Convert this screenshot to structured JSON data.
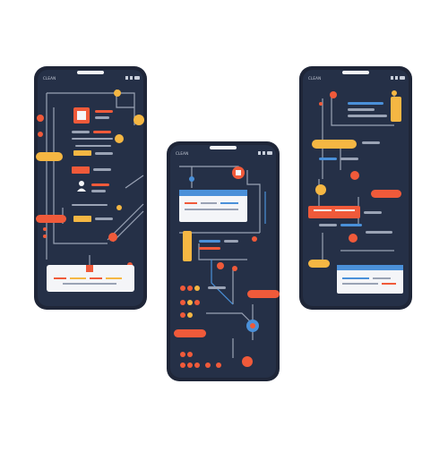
{
  "colors": {
    "background": "#ffffff",
    "phone_body": "#1f2638",
    "phone_screen": "#253047",
    "accent_orange": "#f05a3a",
    "accent_yellow": "#f5b743",
    "accent_blue": "#4a90d9",
    "line_light": "#9aa3b5",
    "card_white": "#f4f5f8"
  },
  "phones": [
    {
      "status_time": "CLEAN",
      "icons": [
        "signal-icon",
        "wifi-icon",
        "battery-icon"
      ]
    },
    {
      "status_time": "CLEAN",
      "icons": [
        "signal-icon",
        "wifi-icon",
        "battery-icon"
      ]
    },
    {
      "status_time": "CLEAN",
      "icons": [
        "signal-icon",
        "wifi-icon",
        "battery-icon"
      ]
    }
  ]
}
